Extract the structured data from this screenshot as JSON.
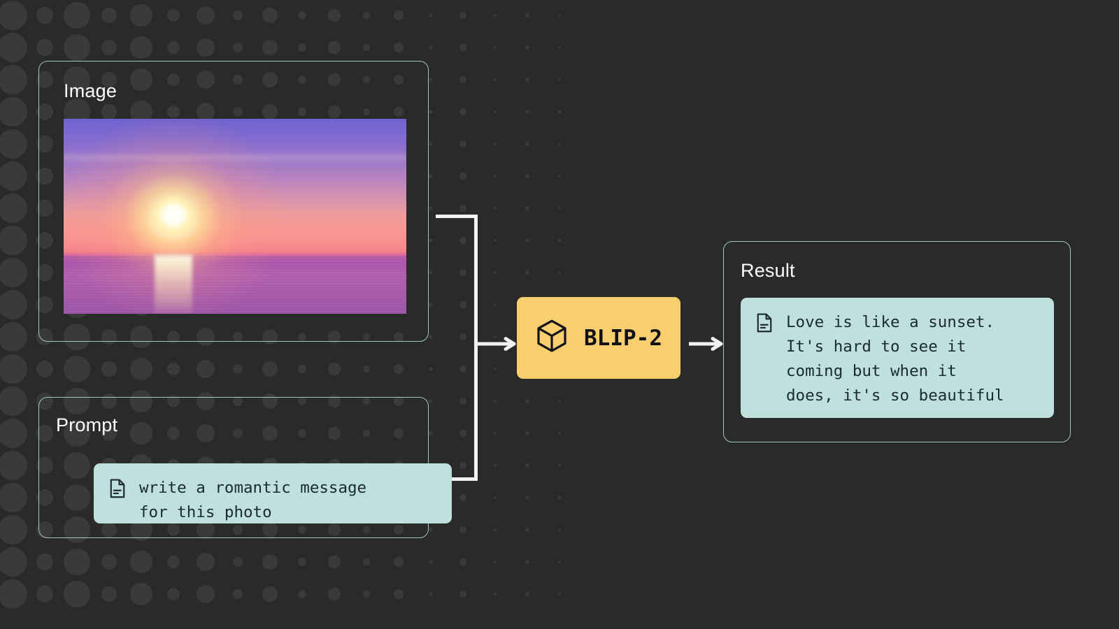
{
  "canvas": {
    "background_color": "#2a2a2a",
    "dot_color": "#3a3a3a"
  },
  "flow": {
    "title_omitted": "",
    "connector_color": "#f2f2f2",
    "card_border_color": "#9fc6c4",
    "mint_box_color": "#bfe0dd",
    "node_color": "#f8ce6e"
  },
  "image_card": {
    "title": "Image",
    "media": {
      "icon": "sunset-photo",
      "description": "sunset over the ocean with purple sky and sun reflection"
    }
  },
  "prompt_card": {
    "title": "Prompt",
    "doc_icon": "document-icon",
    "text": "write a romantic message\nfor this photo"
  },
  "model_node": {
    "icon": "cube-icon",
    "label": "BLIP-2"
  },
  "result_card": {
    "title": "Result",
    "doc_icon": "document-icon",
    "text": "Love is like a sunset.\nIt's hard to see it\ncoming but when it\ndoes, it's so beautiful"
  },
  "arrows": {
    "input_arrow": "arrow-right-icon",
    "output_arrow": "arrow-right-icon"
  }
}
